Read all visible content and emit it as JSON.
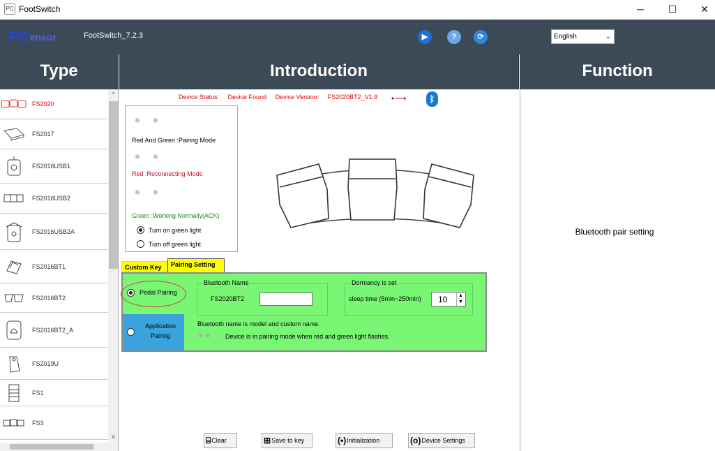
{
  "window": {
    "title": "FootSwitch",
    "app_icon": "PC",
    "minimize_glyph": "─",
    "maximize_glyph": "☐",
    "close_glyph": "✕"
  },
  "header": {
    "logo_pc": "PC",
    "logo_rest": "ensor",
    "version": "FootSwitch_7.2.3",
    "language": "English",
    "icons": [
      "play-icon",
      "help-icon",
      "refresh-icon"
    ]
  },
  "sections": {
    "type": "Type",
    "introduction": "Introduction",
    "function": "Function"
  },
  "sidebar": {
    "items": [
      {
        "label": "FS2020",
        "active": true
      },
      {
        "label": "FS2017"
      },
      {
        "label": "FS2016USB1"
      },
      {
        "label": "FS2016USB2"
      },
      {
        "label": "FS2016USB2A"
      },
      {
        "label": "FS2016BT1"
      },
      {
        "label": "FS2016BT2"
      },
      {
        "label": "FS2016BT2_A"
      },
      {
        "label": "FS2019U"
      },
      {
        "label": "FS1"
      },
      {
        "label": "FS3"
      }
    ]
  },
  "status": {
    "device_status_label": "Device Status:",
    "device_status_value": "Device Found",
    "device_version_label": "Device Version:",
    "device_version_value": "FS2020BT2_V1.9"
  },
  "leds": {
    "pairing": "Red And Green :Pairing Mode",
    "reconnecting": "Red :Reconnecting Mode",
    "working": "Green :Working Normally(ACK)",
    "turn_on": "Turn on green light",
    "turn_off": "Turn off green light"
  },
  "tabs": {
    "custom_key": "Custom Key",
    "pairing_setting": "Pairing Setting"
  },
  "pairing": {
    "pedal_pairing": "Pedal Pairing",
    "application_pairing_1": "Application",
    "application_pairing_2": "Pairing",
    "bt_name_group": "Bluetooth Name",
    "bt_name_model": "FS2020BT2",
    "bt_name_value": "",
    "dormancy_group": "Dormancy is set",
    "sleep_time_label": "sleep time  (5min~250min)",
    "sleep_time_value": "10",
    "note1": "Bluetooth name is model and custom name.",
    "note2": "Device is in pairing mode when red and green light flashes."
  },
  "buttons": {
    "clear": "Clear",
    "save": "Save to key",
    "init": "Initialization",
    "device_settings": "Device Settings"
  },
  "function": {
    "text": "Bluetooth pair setting"
  },
  "colors": {
    "header_bg": "#3c4a57",
    "panel_green": "#79f774",
    "app_blue": "#3aa3de",
    "status_red": "#dd0000",
    "tab_yellow": "#ffff00"
  }
}
